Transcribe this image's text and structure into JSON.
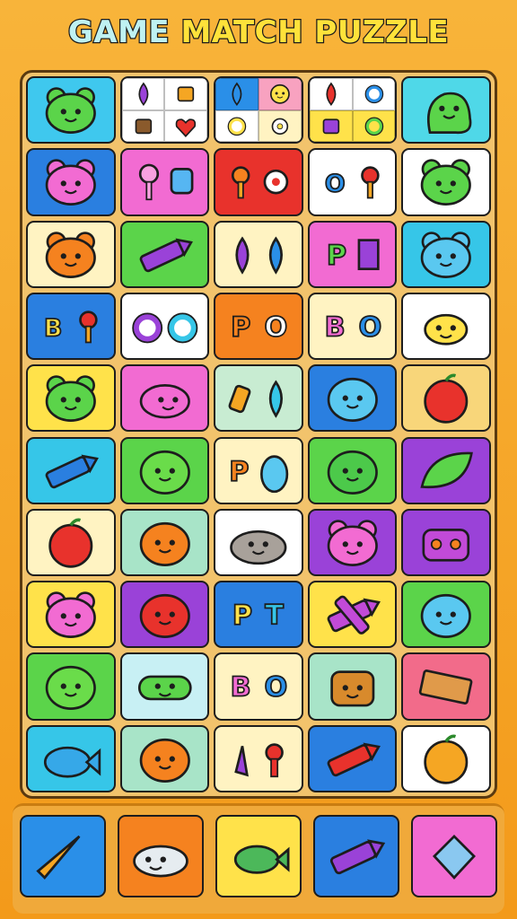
{
  "title": {
    "word1": "GAME",
    "word2": "MATCH PUZZLE"
  },
  "colors": {
    "board": "#f2c36c",
    "frame": "#f6a623",
    "outline": "#1d1d1d",
    "green": "#5bd44a",
    "blue": "#2a8fe8",
    "cyan": "#36c6e8",
    "pink": "#f26bd2",
    "purple": "#9a42d8",
    "orange": "#f5821f",
    "red": "#e8322c",
    "yellow": "#ffe24a",
    "cream": "#fff3c2",
    "white": "#ffffff"
  },
  "grid": {
    "rows": 10,
    "cols": 5,
    "tiles": [
      [
        {
          "bg": "#3fc8ee",
          "icon": "green-bear-icon"
        },
        {
          "bg": "quad",
          "icon": "mixed-small-icons"
        },
        {
          "bg": "quad",
          "icon": "mixed-small-icons"
        },
        {
          "bg": "quad",
          "icon": "mixed-small-icons"
        },
        {
          "bg": "#4fd8e8",
          "icon": "green-monster-icon"
        }
      ],
      [
        {
          "bg": "#2a7fe0",
          "icon": "pink-bear-icon"
        },
        {
          "bg": "#f26bd2",
          "icon": "lollipop-and-cube-icon"
        },
        {
          "bg": "#e8322c",
          "icon": "flower-and-pin-icon"
        },
        {
          "bg": "#ffffff",
          "icon": "letter-and-pin-icon"
        },
        {
          "bg": "#ffffff",
          "icon": "green-bear-icon"
        }
      ],
      [
        {
          "bg": "#fff3c2",
          "icon": "orange-bear-icon"
        },
        {
          "bg": "#5bd44a",
          "icon": "purple-crayon-icon"
        },
        {
          "bg": "#fff3c2",
          "icon": "drops-icon"
        },
        {
          "bg": "#f26bd2",
          "icon": "letter-p-and-box-icon"
        },
        {
          "bg": "#36c6e8",
          "icon": "blue-bear-icon"
        }
      ],
      [
        {
          "bg": "#2a7fe0",
          "icon": "letter-b-and-pin-icon"
        },
        {
          "bg": "#ffffff",
          "icon": "rings-icon"
        },
        {
          "bg": "#f5821f",
          "icon": "letters-p-o-icon"
        },
        {
          "bg": "#fff3c2",
          "icon": "letters-b-o-icon"
        },
        {
          "bg": "#ffffff",
          "icon": "yellow-bug-icon"
        }
      ],
      [
        {
          "bg": "#ffe24a",
          "icon": "green-bear-icon"
        },
        {
          "bg": "#f26bd2",
          "icon": "pink-axolotl-icon"
        },
        {
          "bg": "#c8ecd2",
          "icon": "crayon-and-drop-icon"
        },
        {
          "bg": "#2a7fe0",
          "icon": "blue-cat-icon"
        },
        {
          "bg": "#f8d67a",
          "icon": "tomato-icon"
        }
      ],
      [
        {
          "bg": "#36c6e8",
          "icon": "blue-rocket-icon"
        },
        {
          "bg": "#5bd44a",
          "icon": "green-blob-icon"
        },
        {
          "bg": "#fff3c2",
          "icon": "letter-p-axolotl-icon"
        },
        {
          "bg": "#5bd44a",
          "icon": "green-dino-icon"
        },
        {
          "bg": "#9a42d8",
          "icon": "green-leaf-icon"
        }
      ],
      [
        {
          "bg": "#fff3c2",
          "icon": "apple-icon"
        },
        {
          "bg": "#a8e4c8",
          "icon": "orange-fish-icon"
        },
        {
          "bg": "#ffffff",
          "icon": "gray-cat-icon"
        },
        {
          "bg": "#9a42d8",
          "icon": "pink-bear-icon"
        },
        {
          "bg": "#9a42d8",
          "icon": "purple-robot-icon"
        }
      ],
      [
        {
          "bg": "#ffe24a",
          "icon": "pink-bear-icon"
        },
        {
          "bg": "#9a42d8",
          "icon": "red-cat-icon"
        },
        {
          "bg": "#2a7fe0",
          "icon": "letters-p-t-icon"
        },
        {
          "bg": "#ffe24a",
          "icon": "crossed-crayons-icon"
        },
        {
          "bg": "#5bd44a",
          "icon": "blue-puffer-icon"
        }
      ],
      [
        {
          "bg": "#5bd44a",
          "icon": "green-blob-icon"
        },
        {
          "bg": "#c8f0f4",
          "icon": "green-pill-icon"
        },
        {
          "bg": "#fff3c2",
          "icon": "letters-b-o-icon"
        },
        {
          "bg": "#a8e4c8",
          "icon": "backpack-icon"
        },
        {
          "bg": "#f26b8a",
          "icon": "chocolate-icon"
        }
      ],
      [
        {
          "bg": "#36c6e8",
          "icon": "blue-fish-icon"
        },
        {
          "bg": "#a8e4c8",
          "icon": "orange-cat-icon"
        },
        {
          "bg": "#fff3c2",
          "icon": "crayon-and-robot-icon"
        },
        {
          "bg": "#2a7fe0",
          "icon": "red-crayon-icon"
        },
        {
          "bg": "#ffffff",
          "icon": "orange-ball-icon"
        }
      ]
    ]
  },
  "tray": {
    "slots": [
      {
        "bg": "#2a8fe8",
        "icon": "carrot-icon"
      },
      {
        "bg": "#f5821f",
        "icon": "whale-icon"
      },
      {
        "bg": "#ffe24a",
        "icon": "green-fish-icon"
      },
      {
        "bg": "#2a7fe0",
        "icon": "purple-crayon-icon"
      },
      {
        "bg": "#f26bd2",
        "icon": "crystal-icon"
      }
    ]
  },
  "small_letters": {
    "b": "B",
    "p": "P",
    "o": "O",
    "t": "T"
  }
}
